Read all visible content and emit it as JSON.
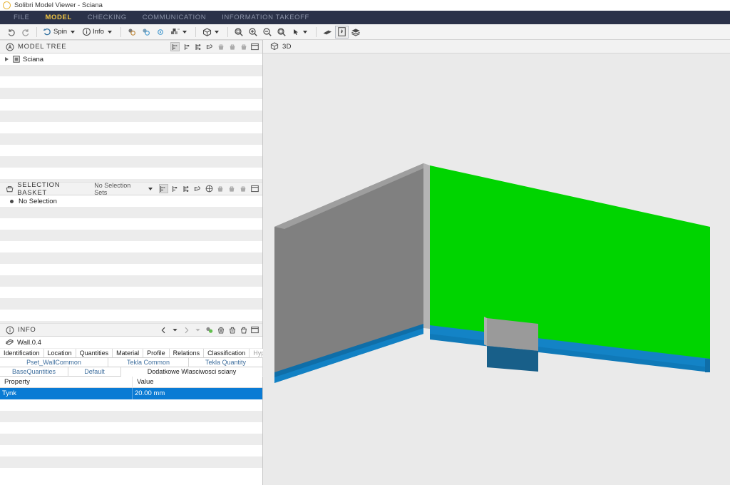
{
  "window": {
    "title": "Solibri Model Viewer - Sciana",
    "app_icon": "solibri-circle-icon"
  },
  "menubar": {
    "items": [
      {
        "label": "FILE",
        "active": false
      },
      {
        "label": "MODEL",
        "active": true
      },
      {
        "label": "CHECKING",
        "active": false
      },
      {
        "label": "COMMUNICATION",
        "active": false
      },
      {
        "label": "INFORMATION TAKEOFF",
        "active": false
      }
    ]
  },
  "toolbar": {
    "undo": "undo-icon",
    "redo": "redo-icon",
    "spin_label": "Spin",
    "info_label": "Info",
    "zoom_tools": [
      "zoom-area-icon",
      "zoom-in-icon",
      "zoom-out-icon",
      "zoom-fit-icon",
      "pick-icon"
    ],
    "right_tools": [
      "clip-icon",
      "walk-icon",
      "layers-icon"
    ]
  },
  "model_tree": {
    "title": "MODEL TREE",
    "icon": "model-tree-icon",
    "header_icons": [
      "expand-branch-icon",
      "collapse-branch-icon",
      "tree-structure-icon",
      "sync-selection-icon",
      "basket-add-icon",
      "basket-remove-icon",
      "basket-clear-icon",
      "maximize-panel-icon"
    ],
    "rows": [
      {
        "label": "Sciana",
        "icon": "building-icon",
        "expandable": true
      }
    ]
  },
  "selection_basket": {
    "title": "SELECTION BASKET",
    "icon": "basket-icon",
    "selection_sets_label": "No Selection Sets",
    "header_icons": [
      "expand-branch-icon",
      "collapse-branch-icon",
      "tree-structure-icon",
      "sync-selection-icon",
      "globe-icon",
      "basket-add-icon",
      "basket-remove-icon",
      "basket-clear-icon",
      "maximize-panel-icon"
    ],
    "rows": [
      {
        "label": "No Selection"
      }
    ]
  },
  "info": {
    "title": "INFO",
    "icon": "info-circle-icon",
    "nav_icons": [
      "prev-icon",
      "history-back-dropdown-icon",
      "next-icon",
      "history-forward-dropdown-icon"
    ],
    "action_icons": [
      "link-objects-icon",
      "add-icon",
      "remove-icon",
      "copy-icon",
      "maximize-panel-icon"
    ],
    "object": {
      "label": "Wall.0.4",
      "icon": "wall-icon"
    },
    "tabs_row1": [
      {
        "label": "Identification",
        "selected": false,
        "muted": false
      },
      {
        "label": "Location",
        "selected": false,
        "muted": false
      },
      {
        "label": "Quantities",
        "selected": false,
        "muted": false
      },
      {
        "label": "Material",
        "selected": false,
        "muted": false
      },
      {
        "label": "Profile",
        "selected": false,
        "muted": false
      },
      {
        "label": "Relations",
        "selected": false,
        "muted": false
      },
      {
        "label": "Classification",
        "selected": false,
        "muted": false
      },
      {
        "label": "Hyperlinks",
        "selected": false,
        "muted": true
      }
    ],
    "tabs_row2": [
      {
        "label": "Pset_WallCommon",
        "selected": false
      },
      {
        "label": "Tekla Common",
        "selected": false
      },
      {
        "label": "Tekla Quantity",
        "selected": false
      }
    ],
    "tabs_row3": [
      {
        "label": "BaseQuantities",
        "selected": false
      },
      {
        "label": "Default",
        "selected": false
      },
      {
        "label": "Dodatkowe Wlasciwosci sciany",
        "selected": true
      }
    ],
    "grid": {
      "columns": [
        "Property",
        "Value"
      ],
      "rows": [
        {
          "property": "Tynk",
          "value": "20.00 mm",
          "selected": true
        }
      ]
    }
  },
  "view3d": {
    "label": "3D",
    "icon": "cube-icon",
    "background": "#eaeaea",
    "colors": {
      "wall_front": "#00d400",
      "wall_side_dark": "#808080",
      "wall_side_light": "#a8a8a8",
      "wall_top": "#9a9a9a",
      "base_blue": "#1383c6",
      "base_blue_dark": "#0f6ea8",
      "opening_blue": "#185f89",
      "opening_head": "#9a9a9a"
    }
  }
}
